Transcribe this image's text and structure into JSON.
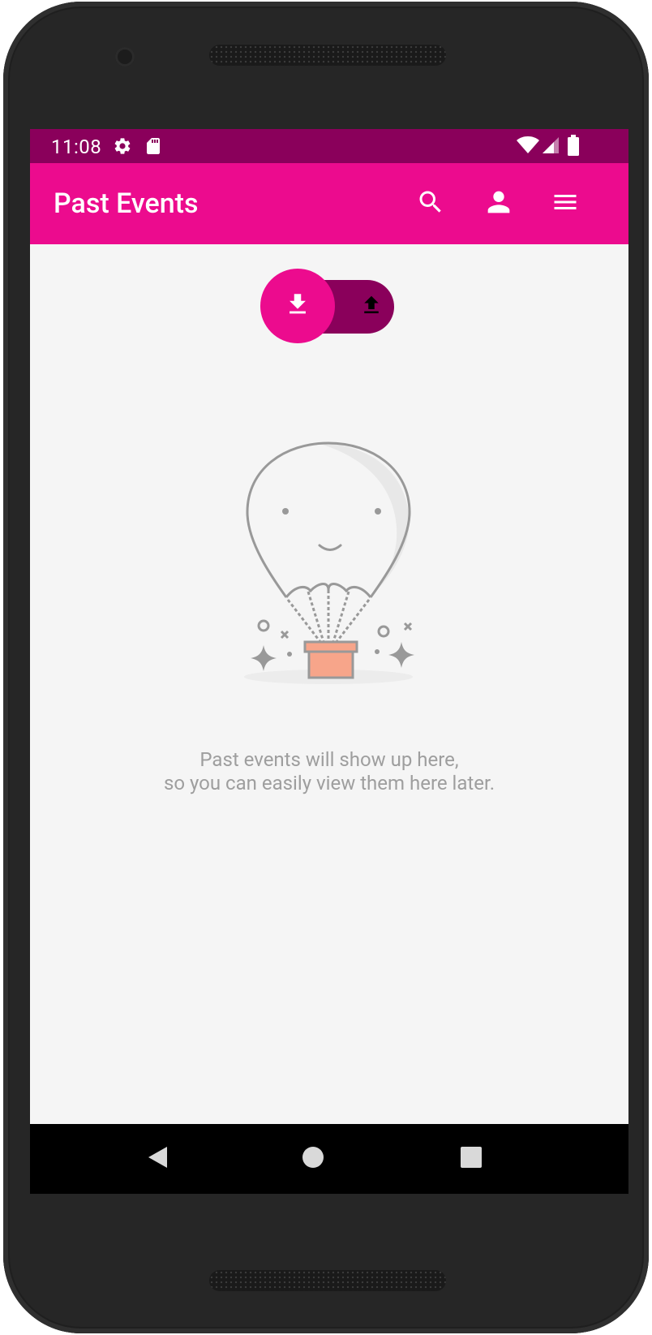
{
  "status_bar": {
    "time": "11:08",
    "icons": [
      "settings-icon",
      "sd-card-icon",
      "wifi-icon",
      "signal-icon",
      "battery-icon"
    ]
  },
  "app_bar": {
    "title": "Past Events",
    "actions": [
      "search-icon",
      "account-icon",
      "menu-icon"
    ]
  },
  "toggle": {
    "selected": "download",
    "options": [
      "download-icon",
      "upload-icon"
    ]
  },
  "empty_state": {
    "line1": "Past events will show up here,",
    "line2": "so you can easily view them here later."
  },
  "nav_bar": {
    "buttons": [
      "back-icon",
      "home-icon",
      "recents-icon"
    ]
  },
  "colors": {
    "primary": "#ec0b8e",
    "primary_dark": "#8a005b",
    "background": "#f5f5f5",
    "empty_text": "#9e9e9e",
    "basket": "#f7a58a"
  }
}
